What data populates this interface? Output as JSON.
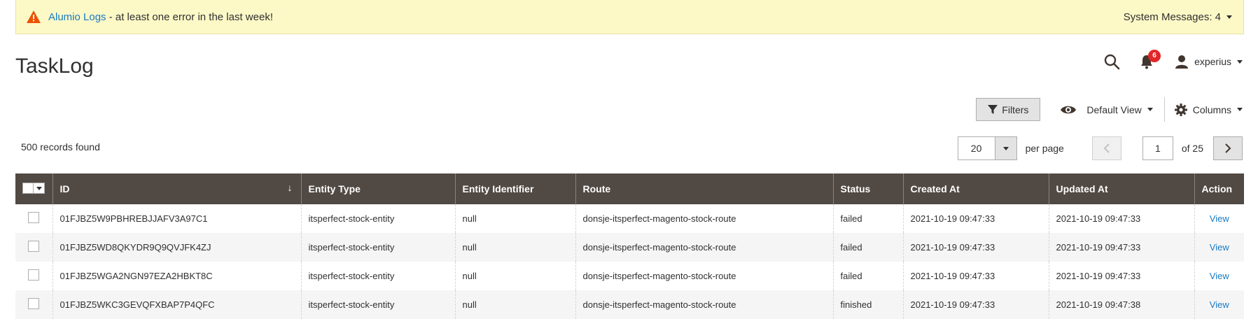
{
  "system_message": {
    "link_text": "Alumio Logs",
    "text": " - at least one error in the last week!",
    "summary": "System Messages: 4"
  },
  "page": {
    "title": "TaskLog"
  },
  "header": {
    "notification_count": "6",
    "username": "experius"
  },
  "toolbar": {
    "filters_label": "Filters",
    "view_label": "Default View",
    "columns_label": "Columns"
  },
  "listing": {
    "records_found": "500 records found",
    "per_page_value": "20",
    "per_page_label": "per page",
    "current_page": "1",
    "total_pages_label": "of 25"
  },
  "table": {
    "headers": [
      "ID",
      "Entity Type",
      "Entity Identifier",
      "Route",
      "Status",
      "Created At",
      "Updated At",
      "Action"
    ],
    "rows": [
      {
        "id": "01FJBZ5W9PBHREBJJAFV3A97C1",
        "entity_type": "itsperfect-stock-entity",
        "entity_identifier": "null",
        "route": "donsje-itsperfect-magento-stock-route",
        "status": "failed",
        "created_at": "2021-10-19 09:47:33",
        "updated_at": "2021-10-19 09:47:33",
        "action": "View"
      },
      {
        "id": "01FJBZ5WD8QKYDR9Q9QVJFK4ZJ",
        "entity_type": "itsperfect-stock-entity",
        "entity_identifier": "null",
        "route": "donsje-itsperfect-magento-stock-route",
        "status": "failed",
        "created_at": "2021-10-19 09:47:33",
        "updated_at": "2021-10-19 09:47:33",
        "action": "View"
      },
      {
        "id": "01FJBZ5WGA2NGN97EZA2HBKT8C",
        "entity_type": "itsperfect-stock-entity",
        "entity_identifier": "null",
        "route": "donsje-itsperfect-magento-stock-route",
        "status": "failed",
        "created_at": "2021-10-19 09:47:33",
        "updated_at": "2021-10-19 09:47:33",
        "action": "View"
      },
      {
        "id": "01FJBZ5WKC3GEVQFXBAP7P4QFC",
        "entity_type": "itsperfect-stock-entity",
        "entity_identifier": "null",
        "route": "donsje-itsperfect-magento-stock-route",
        "status": "finished",
        "created_at": "2021-10-19 09:47:33",
        "updated_at": "2021-10-19 09:47:38",
        "action": "View"
      }
    ]
  },
  "colors": {
    "header_bg": "#514943",
    "link": "#1979c3",
    "message_bg": "#fdf9c7",
    "badge": "#e22626"
  },
  "icons": [
    "warning-icon",
    "caret-down-icon",
    "search-icon",
    "bell-icon",
    "user-icon",
    "filter-icon",
    "eye-icon",
    "gear-icon",
    "chevron-left-icon",
    "chevron-right-icon",
    "sort-down-icon"
  ]
}
